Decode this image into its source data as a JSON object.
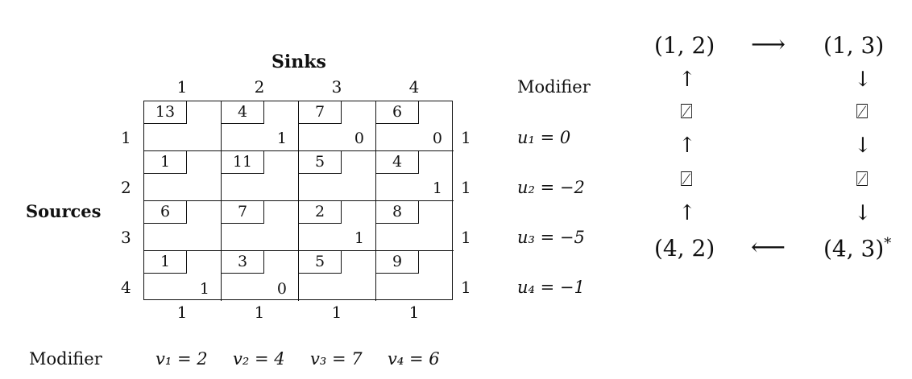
{
  "tableau": {
    "sinks_title": "Sinks",
    "sources_title": "Sources",
    "modifier_title": "Modifier",
    "bottom_modifier_title": "Modifier",
    "sink_headers": [
      "1",
      "2",
      "3",
      "4"
    ],
    "source_headers": [
      "1",
      "2",
      "3",
      "4"
    ],
    "supply": [
      "1",
      "1",
      "1",
      "1"
    ],
    "demand": [
      "1",
      "1",
      "1",
      "1"
    ],
    "row_modifiers": [
      "u₁ = 0",
      "u₂ = −2",
      "u₃ = −5",
      "u₄ = −1"
    ],
    "col_modifiers": [
      "v₁ = 2",
      "v₂ = 4",
      "v₃ = 7",
      "v₄ = 6"
    ],
    "costs": [
      [
        "13",
        "4",
        "7",
        "6"
      ],
      [
        "1",
        "11",
        "5",
        "4"
      ],
      [
        "6",
        "7",
        "2",
        "8"
      ],
      [
        "1",
        "3",
        "5",
        "9"
      ]
    ],
    "allocations": [
      [
        "",
        "1",
        "0",
        "0"
      ],
      [
        "",
        "",
        "",
        "1"
      ],
      [
        "",
        "",
        "1",
        ""
      ],
      [
        "1",
        "0",
        "",
        ""
      ]
    ]
  },
  "loop": {
    "top_left": "(1, 2)",
    "top_right": "(1, 3)",
    "bottom_left": "(4, 2)",
    "bottom_right": "(4, 3)",
    "bottom_right_mark": "*",
    "arrow_right": "⟶",
    "arrow_left": "⟵",
    "arrow_up": "↑",
    "arrow_down": "↓",
    "crossed_box": "⍁"
  }
}
